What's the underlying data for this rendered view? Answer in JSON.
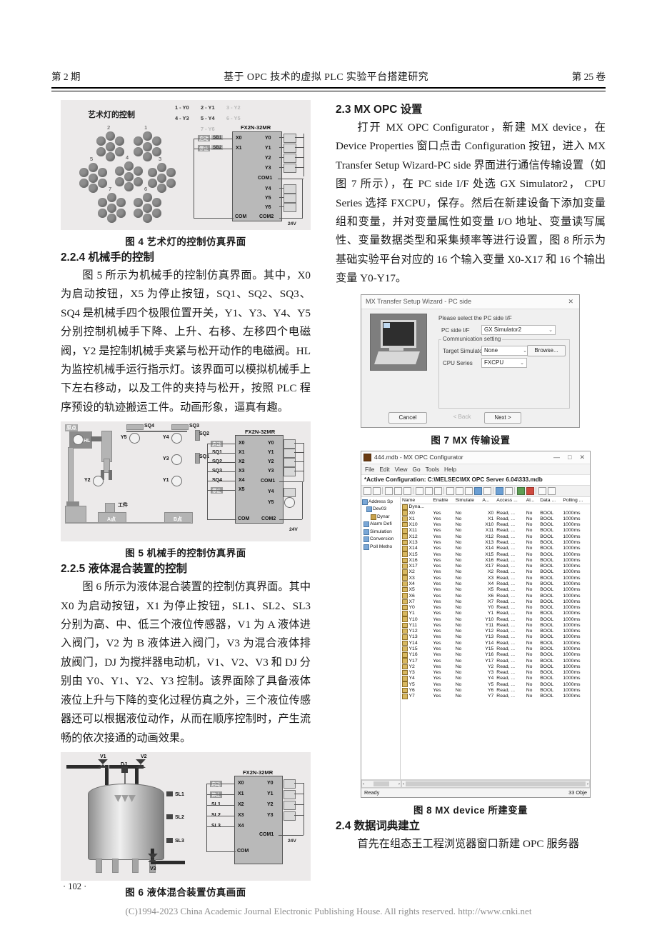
{
  "running_head": {
    "left": "第 2 期",
    "center": "基于 OPC 技术的虚拟 PLC 实验平台搭建研究",
    "right": "第 25 卷"
  },
  "left_column": {
    "fig4_caption": "图 4    艺术灯的控制仿真界面",
    "sec_224_heading": "2.2.4 机械手的控制",
    "para_224": "图 5 所示为机械手的控制仿真界面。其中，X0 为启动按钮，X5 为停止按钮，SQ1、SQ2、SQ3、SQ4 是机械手四个极限位置开关，Y1、Y3、Y4、Y5 分别控制机械手下降、上升、右移、左移四个电磁阀，Y2 是控制机械手夹紧与松开动作的电磁阀。HL 为监控机械手运行指示灯。该界面可以模拟机械手上下左右移动，以及工件的夹持与松开，按照 PLC 程序预设的轨迹搬运工件。动画形象，逼真有趣。",
    "fig5_caption": "图 5   机械手的控制仿真界面",
    "sec_225_heading": "2.2.5 液体混合装置的控制",
    "para_225": "图 6 所示为液体混合装置的控制仿真界面。其中 X0 为启动按钮，X1 为停止按钮，SL1、SL2、SL3 分别为高、中、低三个液位传感器，V1 为 A 液体进入阀门，V2 为 B 液体进入阀门，V3 为混合液体排放阀门，DJ 为搅拌器电动机，V1、V2、V3 和 DJ 分别由 Y0、Y1、Y2、Y3 控制。该界面除了具备液体液位上升与下降的变化过程仿真之外，三个液位传感器还可以根据液位动作，从而在顺序控制时，产生流畅的依次接通的动画效果。",
    "fig6_caption": "图 6   液体混合装置仿真画面"
  },
  "right_column": {
    "sec_23_heading": "2.3   MX OPC 设置",
    "para_23": "打开 MX OPC Configurator，新建 MX device，在 Device Properties 窗口点击 Configuration 按钮，进入 MX Transfer Setup Wizard-PC side 界面进行通信传输设置（如图 7 所示），在 PC side I/F 处选 GX Simulator2， CPU Series 选择 FXCPU，保存。然后在新建设备下添加变量组和变量，并对变量属性如变量 I/O 地址、变量读写属性、变量数据类型和采集频率等进行设置，图 8 所示为基础实验平台对应的 16 个输入变量 X0-X17 和 16 个输出变量 Y0-Y17。",
    "fig7_caption": "图 7   MX 传输设置",
    "fig8_caption": "图 8   MX device 所建变量",
    "sec_24_heading": "2.4  数据词典建立",
    "para_24": "首先在组态王工程浏览器窗口新建 OPC 服务器"
  },
  "figure4": {
    "title": "艺术灯的控制",
    "legend": [
      {
        "text": "1 - Y0",
        "dim": false
      },
      {
        "text": "2 - Y1",
        "dim": false
      },
      {
        "text": "3 - Y2",
        "dim": true
      },
      {
        "text": "4 - Y3",
        "dim": false
      },
      {
        "text": "5 - Y4",
        "dim": false
      },
      {
        "text": "6 - Y5",
        "dim": true
      },
      {
        "text": "7 - Y6",
        "dim": true
      }
    ],
    "cluster_numbers": [
      "1",
      "2",
      "3",
      "4",
      "5",
      "6",
      "7"
    ],
    "plc_model": "FX2N-32MR",
    "input_pins": [
      "X0",
      "X1"
    ],
    "output_pins": [
      "Y0",
      "Y1",
      "Y2",
      "Y3",
      "COM1",
      "Y4",
      "Y5",
      "Y6"
    ],
    "com_pins": [
      "COM",
      "COM2"
    ],
    "switch_labels": [
      "启动",
      "停止"
    ],
    "switch_tags": [
      "SB1",
      "SB2"
    ],
    "supply": "24V"
  },
  "figure5": {
    "plc_model": "FX2N-32MR",
    "origin_label": "原点",
    "indicator_hl": "HL",
    "lamp_labels": [
      "Y5",
      "Y4",
      "Y3",
      "Y2",
      "Y1"
    ],
    "limit_switches": [
      "SQ4",
      "SQ3",
      "SQ2",
      "SQ1"
    ],
    "workpiece": "工件",
    "points": [
      "A点",
      "B点"
    ],
    "input_labels": [
      "启动",
      "SQ1",
      "SQ2",
      "SQ3",
      "SQ4",
      "停止"
    ],
    "input_pins": [
      "X0",
      "X1",
      "X2",
      "X3",
      "X4",
      "X5"
    ],
    "output_pins": [
      "Y0",
      "Y1",
      "Y2",
      "Y3",
      "COM1",
      "Y4",
      "Y5"
    ],
    "com_pins": [
      "COM",
      "COM2"
    ],
    "supply": "24V"
  },
  "figure6": {
    "plc_model": "FX2N-32MR",
    "valves": [
      "V1",
      "V2",
      "V3"
    ],
    "motor": "DJ",
    "sensors": [
      "SL1",
      "SL2",
      "SL3"
    ],
    "input_labels": [
      "启动",
      "停止",
      "SL1",
      "SL2",
      "SL3"
    ],
    "input_pins": [
      "X0",
      "X1",
      "X2",
      "X3",
      "X4"
    ],
    "output_pins": [
      "Y0",
      "Y1",
      "Y2",
      "Y3",
      "COM1"
    ],
    "com_pins": [
      "COM"
    ],
    "supply": "24V"
  },
  "wizard": {
    "title": "MX Transfer Setup Wizard - PC side",
    "close_glyph": "✕",
    "prompt": "Please select the PC side I/F",
    "pc_side_if_label": "PC side I/F",
    "pc_side_if_value": "GX Simulator2",
    "group_label": "Communication setting",
    "target_sim_label": "Target Simulator",
    "target_sim_value": "None",
    "browse_label": "Browse...",
    "cpu_series_label": "CPU Series",
    "cpu_series_value": "FXCPU",
    "cancel_label": "Cancel",
    "back_label": "< Back",
    "next_label": "Next >"
  },
  "configurator": {
    "title": "444.mdb - MX OPC Configurator",
    "min_glyph": "—",
    "max_glyph": "□",
    "close_glyph": "✕",
    "menus": [
      "File",
      "Edit",
      "View",
      "Go",
      "Tools",
      "Help"
    ],
    "active_configuration": "*Active Configuration:  C:\\MELSEC\\MX OPC Server 6.04\\333.mdb",
    "tree": [
      "Address Sp",
      "Dev03",
      "Dynar",
      "Alarm Defi",
      "Simulation",
      "Conversion",
      "Poll Metho"
    ],
    "columns": [
      "Name",
      "Enable",
      "Simulate",
      "A...",
      "Access ...",
      "Al...",
      "Data ...",
      "Polling ..."
    ],
    "first_row_name": "Dyna...",
    "rows": [
      {
        "name": "X0",
        "enable": "Yes",
        "simulate": "No",
        "addr": "X0",
        "access": "Read, ...",
        "alarm": "No",
        "data": "BOOL",
        "polling": "1000ms"
      },
      {
        "name": "X1",
        "enable": "Yes",
        "simulate": "No",
        "addr": "X1",
        "access": "Read, ...",
        "alarm": "No",
        "data": "BOOL",
        "polling": "1000ms"
      },
      {
        "name": "X10",
        "enable": "Yes",
        "simulate": "No",
        "addr": "X10",
        "access": "Read, ...",
        "alarm": "No",
        "data": "BOOL",
        "polling": "1000ms"
      },
      {
        "name": "X11",
        "enable": "Yes",
        "simulate": "No",
        "addr": "X11",
        "access": "Read, ...",
        "alarm": "No",
        "data": "BOOL",
        "polling": "1000ms"
      },
      {
        "name": "X12",
        "enable": "Yes",
        "simulate": "No",
        "addr": "X12",
        "access": "Read, ...",
        "alarm": "No",
        "data": "BOOL",
        "polling": "1000ms"
      },
      {
        "name": "X13",
        "enable": "Yes",
        "simulate": "No",
        "addr": "X13",
        "access": "Read, ...",
        "alarm": "No",
        "data": "BOOL",
        "polling": "1000ms"
      },
      {
        "name": "X14",
        "enable": "Yes",
        "simulate": "No",
        "addr": "X14",
        "access": "Read, ...",
        "alarm": "No",
        "data": "BOOL",
        "polling": "1000ms"
      },
      {
        "name": "X15",
        "enable": "Yes",
        "simulate": "No",
        "addr": "X15",
        "access": "Read, ...",
        "alarm": "No",
        "data": "BOOL",
        "polling": "1000ms"
      },
      {
        "name": "X16",
        "enable": "Yes",
        "simulate": "No",
        "addr": "X16",
        "access": "Read, ...",
        "alarm": "No",
        "data": "BOOL",
        "polling": "1000ms"
      },
      {
        "name": "X17",
        "enable": "Yes",
        "simulate": "No",
        "addr": "X17",
        "access": "Read, ...",
        "alarm": "No",
        "data": "BOOL",
        "polling": "1000ms"
      },
      {
        "name": "X2",
        "enable": "Yes",
        "simulate": "No",
        "addr": "X2",
        "access": "Read, ...",
        "alarm": "No",
        "data": "BOOL",
        "polling": "1000ms"
      },
      {
        "name": "X3",
        "enable": "Yes",
        "simulate": "No",
        "addr": "X3",
        "access": "Read, ...",
        "alarm": "No",
        "data": "BOOL",
        "polling": "1000ms"
      },
      {
        "name": "X4",
        "enable": "Yes",
        "simulate": "No",
        "addr": "X4",
        "access": "Read, ...",
        "alarm": "No",
        "data": "BOOL",
        "polling": "1000ms"
      },
      {
        "name": "X5",
        "enable": "Yes",
        "simulate": "No",
        "addr": "X5",
        "access": "Read, ...",
        "alarm": "No",
        "data": "BOOL",
        "polling": "1000ms"
      },
      {
        "name": "X6",
        "enable": "Yes",
        "simulate": "No",
        "addr": "X6",
        "access": "Read, ...",
        "alarm": "No",
        "data": "BOOL",
        "polling": "1000ms"
      },
      {
        "name": "X7",
        "enable": "Yes",
        "simulate": "No",
        "addr": "X7",
        "access": "Read, ...",
        "alarm": "No",
        "data": "BOOL",
        "polling": "1000ms"
      },
      {
        "name": "Y0",
        "enable": "Yes",
        "simulate": "No",
        "addr": "Y0",
        "access": "Read, ...",
        "alarm": "No",
        "data": "BOOL",
        "polling": "1000ms"
      },
      {
        "name": "Y1",
        "enable": "Yes",
        "simulate": "No",
        "addr": "Y1",
        "access": "Read, ...",
        "alarm": "No",
        "data": "BOOL",
        "polling": "1000ms"
      },
      {
        "name": "Y10",
        "enable": "Yes",
        "simulate": "No",
        "addr": "Y10",
        "access": "Read, ...",
        "alarm": "No",
        "data": "BOOL",
        "polling": "1000ms"
      },
      {
        "name": "Y11",
        "enable": "Yes",
        "simulate": "No",
        "addr": "Y11",
        "access": "Read, ...",
        "alarm": "No",
        "data": "BOOL",
        "polling": "1000ms"
      },
      {
        "name": "Y12",
        "enable": "Yes",
        "simulate": "No",
        "addr": "Y12",
        "access": "Read, ...",
        "alarm": "No",
        "data": "BOOL",
        "polling": "1000ms"
      },
      {
        "name": "Y13",
        "enable": "Yes",
        "simulate": "No",
        "addr": "Y13",
        "access": "Read, ...",
        "alarm": "No",
        "data": "BOOL",
        "polling": "1000ms"
      },
      {
        "name": "Y14",
        "enable": "Yes",
        "simulate": "No",
        "addr": "Y14",
        "access": "Read, ...",
        "alarm": "No",
        "data": "BOOL",
        "polling": "1000ms"
      },
      {
        "name": "Y15",
        "enable": "Yes",
        "simulate": "No",
        "addr": "Y15",
        "access": "Read, ...",
        "alarm": "No",
        "data": "BOOL",
        "polling": "1000ms"
      },
      {
        "name": "Y16",
        "enable": "Yes",
        "simulate": "No",
        "addr": "Y16",
        "access": "Read, ...",
        "alarm": "No",
        "data": "BOOL",
        "polling": "1000ms"
      },
      {
        "name": "Y17",
        "enable": "Yes",
        "simulate": "No",
        "addr": "Y17",
        "access": "Read, ...",
        "alarm": "No",
        "data": "BOOL",
        "polling": "1000ms"
      },
      {
        "name": "Y2",
        "enable": "Yes",
        "simulate": "No",
        "addr": "Y2",
        "access": "Read, ...",
        "alarm": "No",
        "data": "BOOL",
        "polling": "1000ms"
      },
      {
        "name": "Y3",
        "enable": "Yes",
        "simulate": "No",
        "addr": "Y3",
        "access": "Read, ...",
        "alarm": "No",
        "data": "BOOL",
        "polling": "1000ms"
      },
      {
        "name": "Y4",
        "enable": "Yes",
        "simulate": "No",
        "addr": "Y4",
        "access": "Read, ...",
        "alarm": "No",
        "data": "BOOL",
        "polling": "1000ms"
      },
      {
        "name": "Y5",
        "enable": "Yes",
        "simulate": "No",
        "addr": "Y5",
        "access": "Read, ...",
        "alarm": "No",
        "data": "BOOL",
        "polling": "1000ms"
      },
      {
        "name": "Y6",
        "enable": "Yes",
        "simulate": "No",
        "addr": "Y6",
        "access": "Read, ...",
        "alarm": "No",
        "data": "BOOL",
        "polling": "1000ms"
      },
      {
        "name": "Y7",
        "enable": "Yes",
        "simulate": "No",
        "addr": "Y7",
        "access": "Read, ...",
        "alarm": "No",
        "data": "BOOL",
        "polling": "1000ms"
      }
    ],
    "status_left": "Ready",
    "status_right": "33 Obje"
  },
  "footer": {
    "page_number": "· 102 ·",
    "copyright": "(C)1994-2023 China Academic Journal Electronic Publishing House. All rights reserved.     http://www.cnki.net"
  }
}
